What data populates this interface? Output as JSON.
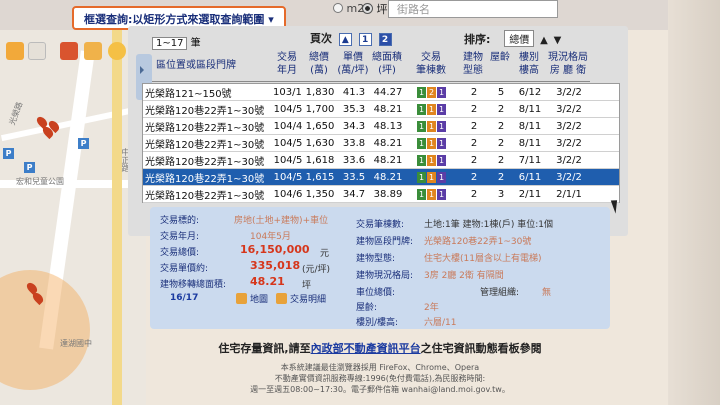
{
  "hint": "框選查詢:以矩形方式來選取查詢範圍",
  "units": {
    "m2": "m2",
    "ping": "坪"
  },
  "address_placeholder": "街路名",
  "page_select": "1~17",
  "page_select_suffix": "筆",
  "page_nav": {
    "label": "頁次",
    "pages": [
      "1",
      "2"
    ],
    "active": "2"
  },
  "sort": {
    "label": "排序:",
    "value": "總價"
  },
  "columns": [
    {
      "label": "區位置或區段門牌"
    },
    {
      "label": "交易\n年月"
    },
    {
      "label": "總價\n(萬)"
    },
    {
      "label": "單價\n(萬/坪)"
    },
    {
      "label": "總面積\n(坪)"
    },
    {
      "label": "交易\n筆棟數"
    },
    {
      "label": "建物\n型態"
    },
    {
      "label": "屋齡"
    },
    {
      "label": "樓別\n樓高"
    },
    {
      "label": "現況格局\n房 廳 衛"
    }
  ],
  "rows": [
    {
      "addr": "光榮路121~150號",
      "date": "103/11",
      "total": "1,830",
      "unit": "41.3",
      "area": "44.27",
      "badges": [
        "1",
        "2",
        "1"
      ],
      "type": "2",
      "age": "5",
      "floor": "6/12",
      "layout": "3/2/2"
    },
    {
      "addr": "光榮路120巷22弄1~30號",
      "date": "104/5",
      "total": "1,700",
      "unit": "35.3",
      "area": "48.21",
      "badges": [
        "1",
        "1",
        "1"
      ],
      "type": "2",
      "age": "2",
      "floor": "8/11",
      "layout": "3/2/2"
    },
    {
      "addr": "光榮路120巷22弄1~30號",
      "date": "104/4",
      "total": "1,650",
      "unit": "34.3",
      "area": "48.13",
      "badges": [
        "1",
        "1",
        "1"
      ],
      "type": "2",
      "age": "2",
      "floor": "8/11",
      "layout": "3/2/2"
    },
    {
      "addr": "光榮路120巷22弄1~30號",
      "date": "104/5",
      "total": "1,630",
      "unit": "33.8",
      "area": "48.21",
      "badges": [
        "1",
        "1",
        "1"
      ],
      "type": "2",
      "age": "2",
      "floor": "8/11",
      "layout": "3/2/2"
    },
    {
      "addr": "光榮路120巷22弄1~30號",
      "date": "104/5",
      "total": "1,618",
      "unit": "33.6",
      "area": "48.21",
      "badges": [
        "1",
        "1",
        "1"
      ],
      "type": "2",
      "age": "2",
      "floor": "7/11",
      "layout": "3/2/2"
    },
    {
      "addr": "光榮路120巷22弄1~30號",
      "date": "104/5",
      "total": "1,615",
      "unit": "33.5",
      "area": "48.21",
      "badges": [
        "1",
        "1",
        "1"
      ],
      "type": "2",
      "age": "2",
      "floor": "6/11",
      "layout": "3/2/2",
      "selected": true
    },
    {
      "addr": "光榮路120巷22弄1~30號",
      "date": "104/6",
      "total": "1,350",
      "unit": "34.7",
      "area": "38.89",
      "badges": [
        "1",
        "1",
        "1"
      ],
      "type": "2",
      "age": "3",
      "floor": "2/11",
      "layout": "2/1/1"
    }
  ],
  "detail": {
    "category_label": "交易標的:",
    "category": "房地(土地+建物)+車位",
    "date_label": "交易年月:",
    "date": "104年5月",
    "total_label": "交易總價:",
    "total": "16,150,000",
    "total_unit": "元",
    "unit_price_label": "交易單價約:",
    "unit_price": "335,018",
    "unit_price_unit": "(元/坪)",
    "area_label": "建物移轉總面積:",
    "area": "48.21",
    "area_unit": "坪",
    "index": "16/17",
    "btn_map": "地圖",
    "btn_detail": "交易明細",
    "count_label": "交易筆棟數:",
    "count": "土地:1筆 建物:1棟(戶) 車位:1個",
    "block_label": "建物區段門牌:",
    "block": "光榮路120巷22弄1~30號",
    "form_label": "建物型態:",
    "form": "住宅大樓(11層含以上有電梯)",
    "layout_label": "建物現況格局:",
    "layout": "3房 2廳 2衛 有隔間",
    "parking_label": "車位總價:",
    "mgmt_label": "管理組織:",
    "mgmt": "無",
    "age_label": "屋齡:",
    "age": "2年",
    "floor_label": "樓別/樓高:",
    "floor": "六層/11"
  },
  "footer": {
    "pre": "住宅存量資訊,請至",
    "link": "內政部不動產資訊平台",
    "post": "之住宅資訊動態看板參閱",
    "line1": "本系統建議最佳瀏覽器採用 FireFox、Chrome、Opera",
    "line2": "不動產實價資訊服務專線:1996(免付費電話),為民服務時間:",
    "line3": "週一至週五08:00~17:30。電子郵件信箱 wanhai@land.moi.gov.tw。"
  },
  "map": {
    "road_1": "光榮路",
    "road_2": "中正路",
    "poi_1": "宏和兒童公園",
    "poi_2": "達湖國中"
  },
  "colors": {
    "accent": "#1f5eae",
    "price": "#d6361b",
    "label": "#1a2f7a",
    "highlight_border": "#e56a2a"
  }
}
